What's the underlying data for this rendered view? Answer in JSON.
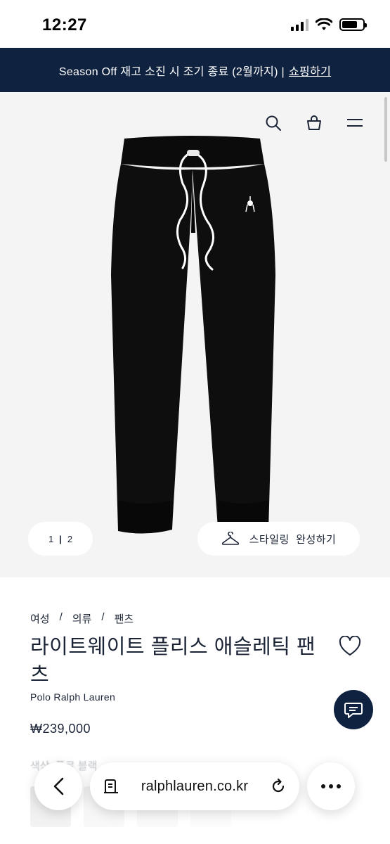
{
  "status_bar": {
    "time": "12:27"
  },
  "promo": {
    "text": "Season Off 재고 소진 시 조기 종료 (2월까지) |",
    "link": "쇼핑하기"
  },
  "hero": {
    "pager": {
      "current": "1",
      "separator": "|",
      "total": "2"
    },
    "styling_button": "스타일링  완성하기"
  },
  "product": {
    "breadcrumb": [
      "여성",
      "의류",
      "팬츠"
    ],
    "title": "라이트웨이트 플리스 애슬레틱 팬츠",
    "brand": "Polo Ralph Lauren",
    "price": "₩239,000",
    "color_label": "색상: 폴로 블랙"
  },
  "browser": {
    "url": "ralphlauren.co.kr"
  },
  "colors": {
    "navy": "#0f2240",
    "hero_bg": "#f4f4f4",
    "text": "#1b2436"
  }
}
